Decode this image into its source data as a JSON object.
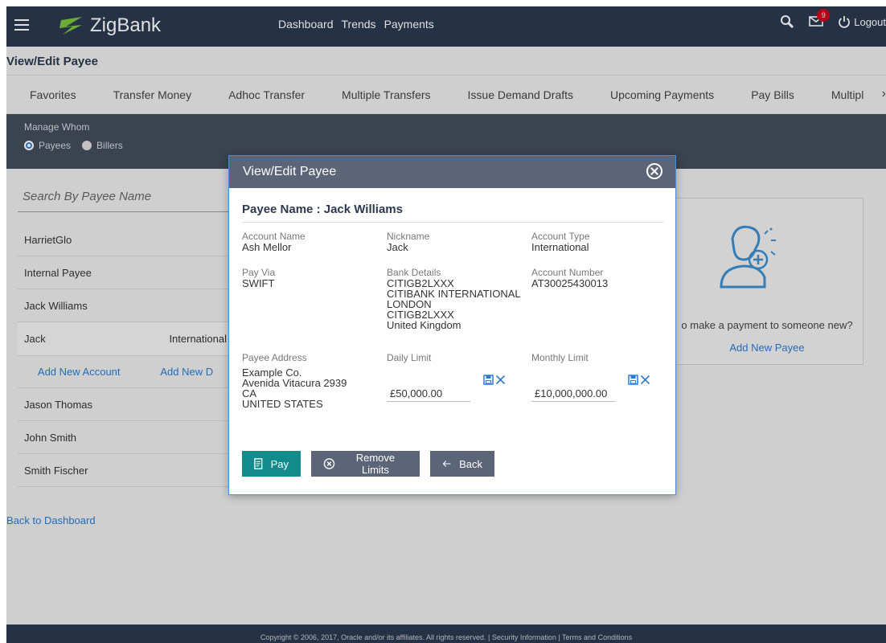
{
  "app": {
    "brand": "ZigBank",
    "topnav": [
      "Dashboard",
      "Trends",
      "Payments"
    ],
    "notification_count": "9",
    "logout_label": "Logout"
  },
  "page": {
    "title": "View/Edit Payee",
    "tabs": [
      "Favorites",
      "Transfer Money",
      "Adhoc Transfer",
      "Multiple Transfers",
      "Issue Demand Drafts",
      "Upcoming Payments",
      "Pay Bills",
      "Multipl"
    ],
    "manage_label": "Manage Whom",
    "radio_payees": "Payees",
    "radio_billers": "Billers",
    "search_placeholder": "Search By Payee Name",
    "payees": [
      "HarrietGlo",
      "Internal Payee",
      "Jack Williams",
      "Jason Thomas",
      "John Smith",
      "Smith Fischer"
    ],
    "expanded_account": {
      "name": "Jack",
      "type": "International"
    },
    "add_new_account": "Add New Account",
    "add_new_d": "Add New D",
    "back_to_dashboard": "Back to Dashboard",
    "card_text": "o make a payment to someone new?",
    "card_link": "Add New Payee",
    "footer": "Copyright © 2006, 2017, Oracle and/or its affiliates. All rights reserved. | Security Information | Terms and Conditions"
  },
  "modal": {
    "title": "View/Edit Payee",
    "payee_name": "Payee Name : Jack Williams",
    "account_name_label": "Account Name",
    "account_name": "Ash Mellor",
    "nickname_label": "Nickname",
    "nickname": "Jack",
    "account_type_label": "Account Type",
    "account_type": "International",
    "pay_via_label": "Pay Via",
    "pay_via": "SWIFT",
    "bank_details_label": "Bank Details",
    "bank_details": [
      "CITIGB2LXXX",
      "CITIBANK INTERNATIONAL",
      "LONDON",
      "CITIGB2LXXX",
      "United Kingdom"
    ],
    "account_number_label": "Account Number",
    "account_number": "AT30025430013",
    "payee_address_label": "Payee Address",
    "payee_address": [
      "Example Co.",
      "Avenida Vitacura 2939",
      "CA",
      "UNITED STATES"
    ],
    "daily_limit_label": "Daily Limit",
    "daily_limit": "£50,000.00",
    "monthly_limit_label": "Monthly Limit",
    "monthly_limit": "£10,000,000.00",
    "pay_label": "Pay",
    "remove_limits_label": "Remove Limits",
    "back_label": "Back"
  },
  "colors": {
    "header_bg": "#2b3a4f",
    "modal_header": "#5c6478",
    "pay_button": "#138a8c",
    "link": "#2b7bd0"
  }
}
